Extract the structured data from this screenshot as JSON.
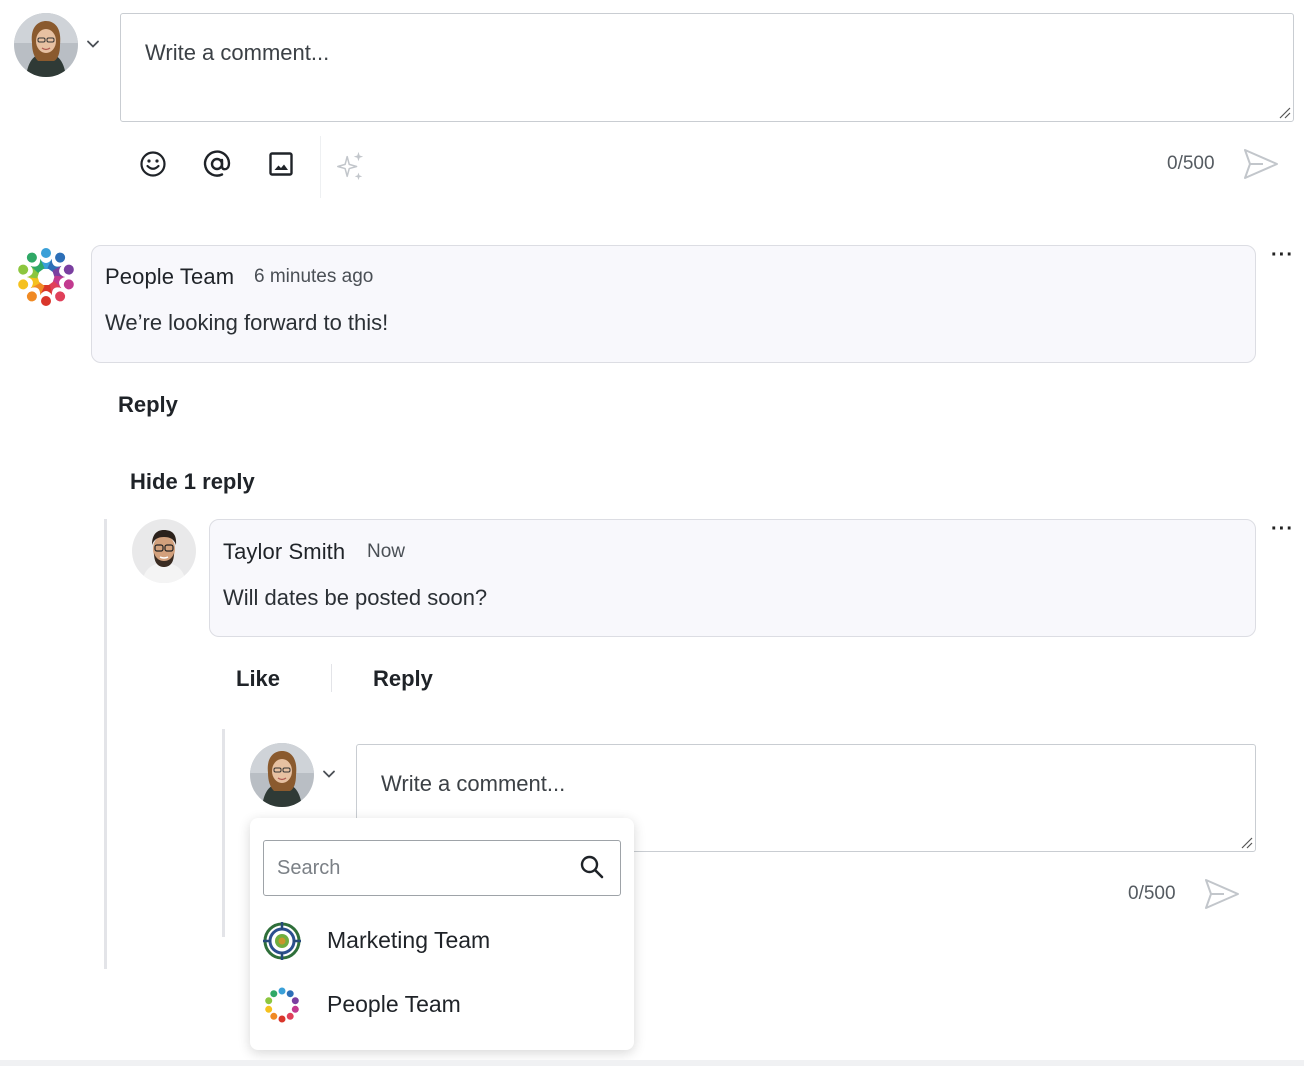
{
  "composer": {
    "placeholder": "Write a comment...",
    "counter": "0/500"
  },
  "comment": {
    "author": "People Team",
    "time": "6 minutes ago",
    "text": "We’re looking forward to this!",
    "kebab": "···",
    "reply_label": "Reply",
    "toggle_replies_label": "Hide 1 reply"
  },
  "reply": {
    "author": "Taylor Smith",
    "time": "Now",
    "text": "Will dates be posted soon?",
    "kebab": "···",
    "like_label": "Like",
    "reply_label": "Reply"
  },
  "reply_composer": {
    "placeholder": "Write a comment...",
    "counter": "0/500"
  },
  "identity_dropdown": {
    "search_placeholder": "Search",
    "options": [
      {
        "label": "Marketing Team"
      },
      {
        "label": "People Team"
      }
    ]
  },
  "icons": {
    "toolbar": [
      "emoji-icon",
      "mention-icon",
      "image-icon",
      "ai-sparkle-icon"
    ],
    "send": "send-icon",
    "chevron": "chevron-down-icon",
    "search": "search-icon"
  }
}
